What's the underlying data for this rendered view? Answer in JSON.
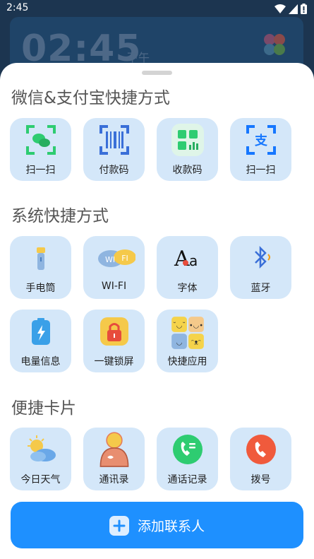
{
  "status_bar": {
    "time": "2:45"
  },
  "background_widget": {
    "clock": "02:45",
    "ampm": "下午"
  },
  "sections": {
    "wechat_alipay": {
      "title": "微信&支付宝快捷方式",
      "items": [
        {
          "label": "扫一扫",
          "icon": "wechat-scan-icon"
        },
        {
          "label": "付款码",
          "icon": "payment-code-icon"
        },
        {
          "label": "收款码",
          "icon": "receive-code-icon"
        },
        {
          "label": "扫一扫",
          "icon": "alipay-scan-icon"
        }
      ]
    },
    "system": {
      "title": "系统快捷方式",
      "items": [
        {
          "label": "手电筒",
          "icon": "flashlight-icon"
        },
        {
          "label": "WI-FI",
          "icon": "wifi-icon"
        },
        {
          "label": "字体",
          "icon": "font-icon"
        },
        {
          "label": "蓝牙",
          "icon": "bluetooth-icon"
        },
        {
          "label": "电量信息",
          "icon": "battery-icon"
        },
        {
          "label": "一键锁屏",
          "icon": "lock-screen-icon"
        },
        {
          "label": "快捷应用",
          "icon": "quick-apps-icon"
        }
      ]
    },
    "cards": {
      "title": "便捷卡片",
      "items": [
        {
          "label": "今日天气",
          "icon": "weather-icon"
        },
        {
          "label": "通讯录",
          "icon": "contacts-icon"
        },
        {
          "label": "通话记录",
          "icon": "call-log-icon"
        },
        {
          "label": "拨号",
          "icon": "dialer-icon"
        }
      ]
    }
  },
  "add_contact": {
    "label": "添加联系人"
  },
  "colors": {
    "accent": "#1e90ff",
    "tile_bg": "#d4e7f9",
    "sheet_bg": "#ffffff"
  }
}
